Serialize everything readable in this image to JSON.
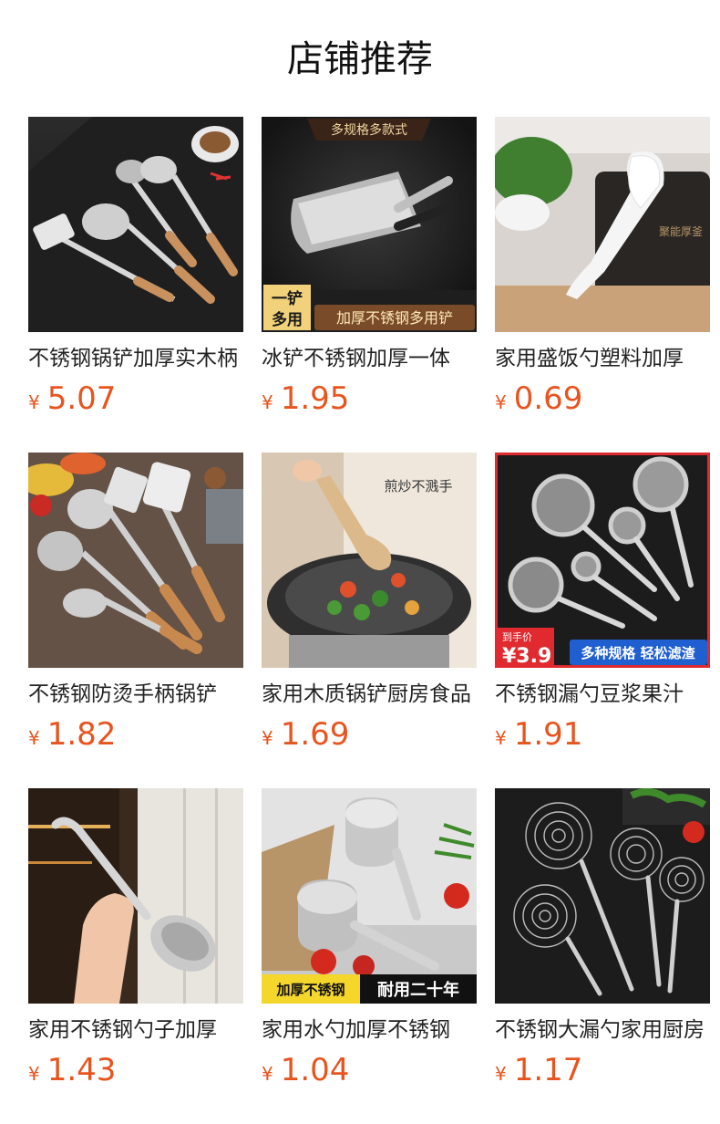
{
  "section_title": "店铺推荐",
  "colors": {
    "price": "#e8541e"
  },
  "products": [
    {
      "name": "不锈钢锅铲加厚实木柄",
      "currency": "¥",
      "price": "5.07",
      "image_icon": "ladle-set-image",
      "badge_top": "",
      "badge_left": "",
      "badge_right": "",
      "badge_price_label": "",
      "badge_price": ""
    },
    {
      "name": "冰铲不锈钢加厚一体",
      "currency": "¥",
      "price": "1.95",
      "image_icon": "ice-scoop-image",
      "badge_top": "多规格多款式",
      "badge_left": "一铲 多用",
      "badge_right": "加厚不锈钢多用铲",
      "badge_price_label": "",
      "badge_price": ""
    },
    {
      "name": "家用盛饭勺塑料加厚",
      "currency": "¥",
      "price": "0.69",
      "image_icon": "rice-paddle-image",
      "badge_top": "",
      "badge_left": "",
      "badge_right": "",
      "badge_price_label": "",
      "badge_price": ""
    },
    {
      "name": "不锈钢防烫手柄锅铲",
      "currency": "¥",
      "price": "1.82",
      "image_icon": "utensil-set-image",
      "badge_top": "",
      "badge_left": "",
      "badge_right": "",
      "badge_price_label": "",
      "badge_price": ""
    },
    {
      "name": "家用木质锅铲厨房食品",
      "currency": "¥",
      "price": "1.69",
      "image_icon": "wooden-spatula-image",
      "badge_top": "煎炒不溅手",
      "badge_left": "",
      "badge_right": "",
      "badge_price_label": "",
      "badge_price": ""
    },
    {
      "name": "不锈钢漏勺豆浆果汁",
      "currency": "¥",
      "price": "1.91",
      "image_icon": "strainer-set-image",
      "badge_top": "",
      "badge_left": "",
      "badge_right": "多种规格 轻松滤渣",
      "badge_price_label": "到手价",
      "badge_price": "¥3.9"
    },
    {
      "name": "家用不锈钢勺子加厚",
      "currency": "¥",
      "price": "1.43",
      "image_icon": "spoon-image",
      "badge_top": "",
      "badge_left": "",
      "badge_right": "",
      "badge_price_label": "",
      "badge_price": ""
    },
    {
      "name": "家用水勺加厚不锈钢",
      "currency": "¥",
      "price": "1.04",
      "image_icon": "water-ladle-image",
      "badge_top": "",
      "badge_left": "加厚不锈钢",
      "badge_right": "耐用二十年",
      "badge_price_label": "",
      "badge_price": ""
    },
    {
      "name": "不锈钢大漏勺家用厨房",
      "currency": "¥",
      "price": "1.17",
      "image_icon": "wire-skimmer-image",
      "badge_top": "",
      "badge_left": "",
      "badge_right": "",
      "badge_price_label": "",
      "badge_price": ""
    }
  ]
}
